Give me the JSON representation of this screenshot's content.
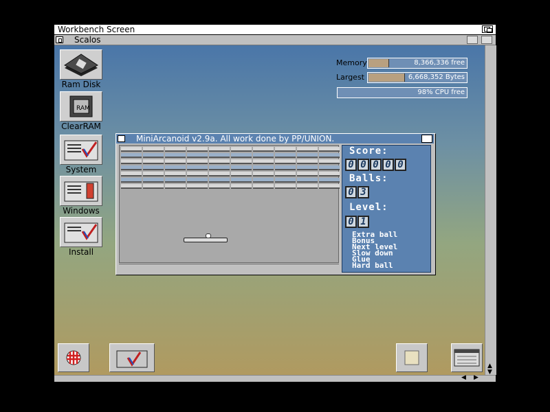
{
  "screen": {
    "title": "Workbench Screen"
  },
  "window": {
    "title": "Scalos"
  },
  "icons": [
    {
      "label": "Ram Disk"
    },
    {
      "label": "ClearRAM"
    },
    {
      "label": "System"
    },
    {
      "label": "Windows"
    },
    {
      "label": "Install"
    }
  ],
  "gauges": {
    "memory": {
      "label": "Memory",
      "value": "8,366,336 free",
      "fraction": 0.2
    },
    "largest": {
      "label": "Largest",
      "value": "6,668,352 Bytes",
      "fraction": 0.36
    },
    "cpu": {
      "value": "98% CPU free",
      "fraction": 0.0
    }
  },
  "game": {
    "title": "MiniArcanoid v2.9a. All work done by PP/UNION.",
    "score_label": "Score:",
    "score_digits": [
      "0",
      "0",
      "0",
      "0",
      "0"
    ],
    "balls_label": "Balls:",
    "balls_digits": [
      "0",
      "3"
    ],
    "level_label": "Level:",
    "level_digits": [
      "0",
      "1"
    ],
    "bonuses": [
      "Extra ball",
      "Bonus",
      "Next level",
      "Slow down",
      "Glue",
      "Hard ball"
    ]
  },
  "colors": {
    "desktop_top": "#4a76a8",
    "desktop_bottom": "#b09a60",
    "panel": "#5b82b0"
  }
}
